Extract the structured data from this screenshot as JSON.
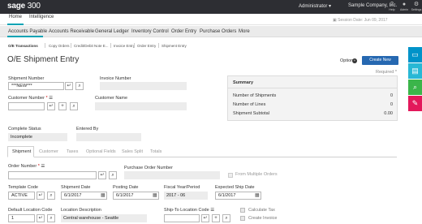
{
  "topbar": {
    "brand": "sage",
    "brand_num": "300",
    "user": "Administrator",
    "company": "Sample Company, Inc.",
    "icons": [
      {
        "name": "help-icon",
        "glyph": "?",
        "label": "Help"
      },
      {
        "name": "user-icon",
        "glyph": "●",
        "label": "Admin"
      },
      {
        "name": "gear-icon",
        "glyph": "⚙",
        "label": "Settings"
      }
    ]
  },
  "module_tabs": {
    "home": "Home",
    "intelligence": "Intelligence",
    "session_date": "Session Date: Jun 09, 2017"
  },
  "module_nav": [
    "Accounts Payable",
    "Accounts Receivable",
    "General Ledger",
    "Inventory Control",
    "Order Entry",
    "Purchase Orders",
    "More"
  ],
  "breadcrumbs": [
    "O/E Transactions",
    "Copy Orders",
    "Credit/Debit Note E...",
    "Invoice Entry",
    "Order Entry",
    "Shipment Entry"
  ],
  "header": {
    "title": "O/E Shipment Entry",
    "options_label": "Options",
    "create_new_label": "Create New",
    "required_note": "Required *"
  },
  "colors": {
    "accent": "#00a3b4",
    "primary_button": "#2668b1",
    "dock": [
      "#0093c9",
      "#28b8d5",
      "#3bb54a",
      "#e3185b"
    ]
  },
  "dock_icons": [
    "window-icon",
    "document-icon",
    "search-icon",
    "pencil-icon"
  ],
  "form": {
    "shipment_number_label": "Shipment Number",
    "shipment_number_value": "***NEW***",
    "invoice_number_label": "Invoice Number",
    "customer_number_label": "Customer Number",
    "customer_name_label": "Customer Name",
    "complete_status_label": "Complete Status",
    "complete_status_value": "Incomplete",
    "entered_by_label": "Entered By"
  },
  "summary": {
    "title": "Summary",
    "rows": [
      {
        "label": "Number of Shipments",
        "value": "0"
      },
      {
        "label": "Number of Lines",
        "value": "0"
      },
      {
        "label": "Shipment Subtotal",
        "value": "0.00"
      }
    ]
  },
  "detail_tabs": [
    "Shipment",
    "Customer",
    "Taxes",
    "Optional Fields",
    "Sales Split",
    "Totals"
  ],
  "shipment_tab": {
    "order_number_label": "Order Number",
    "po_number_label": "Purchase Order Number",
    "from_multiple_orders": "From Multiple Orders",
    "template_code_label": "Template Code",
    "template_code_value": "ACTIVE",
    "shipment_date_label": "Shipment Date",
    "shipment_date_value": "6/1/2017",
    "posting_date_label": "Posting Date",
    "posting_date_value": "6/1/2017",
    "fiscal_period_label": "Fiscal Year/Period",
    "fiscal_period_value": "2017 - 06",
    "expected_ship_date_label": "Expected Ship Date",
    "expected_ship_date_value": "6/1/2017",
    "default_location_label": "Default Location Code",
    "default_location_value": "1",
    "location_description_label": "Location Description",
    "location_description_value": "Central warehouse - Seattle",
    "ship_to_label": "Ship-To Location Code",
    "calculate_tax": "Calculate Tax",
    "create_invoice": "Create Invoice"
  }
}
